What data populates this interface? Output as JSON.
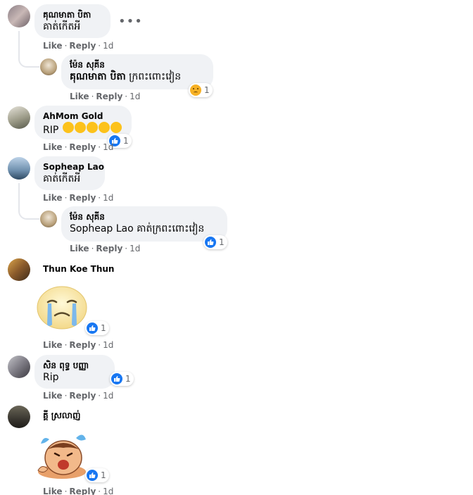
{
  "actions": {
    "like": "Like",
    "reply": "Reply",
    "time": "1d",
    "sep": "·"
  },
  "comments": [
    {
      "name": "គុណមាតា បិតា",
      "text": "គាត់កើតអី"
    },
    {
      "name": "ម៉ែន សុគីន",
      "tag": "គុណមាតា បិតា",
      "text": " ក្រពះពោះវៀន",
      "reaction_count": "1"
    },
    {
      "name": "AhMom Gold",
      "text": "RIP",
      "reaction_count": "1"
    },
    {
      "name": "Sopheap Lao",
      "text": "គាត់កើតអី"
    },
    {
      "name": "ម៉ែន សុគីន",
      "tag": "Sopheap Lao",
      "text": " គាត់ក្រពះពោះវៀន",
      "reaction_count": "1"
    },
    {
      "name": "Thun Koe Thun",
      "sticker": "crying-face-sticker",
      "reaction_count": "1"
    },
    {
      "name": "សិន ពុទ្ធ បញ្ញា",
      "text": "Rip",
      "reaction_count": "1"
    },
    {
      "name": "គ្គី ស្រលាញ់",
      "sticker": "crying-character-sticker",
      "reaction_count": "1"
    }
  ],
  "more_label": "•••",
  "colors": {
    "bubble": "#f0f2f5",
    "like_blue": "#1877f2",
    "meta_gray": "#65676b"
  }
}
